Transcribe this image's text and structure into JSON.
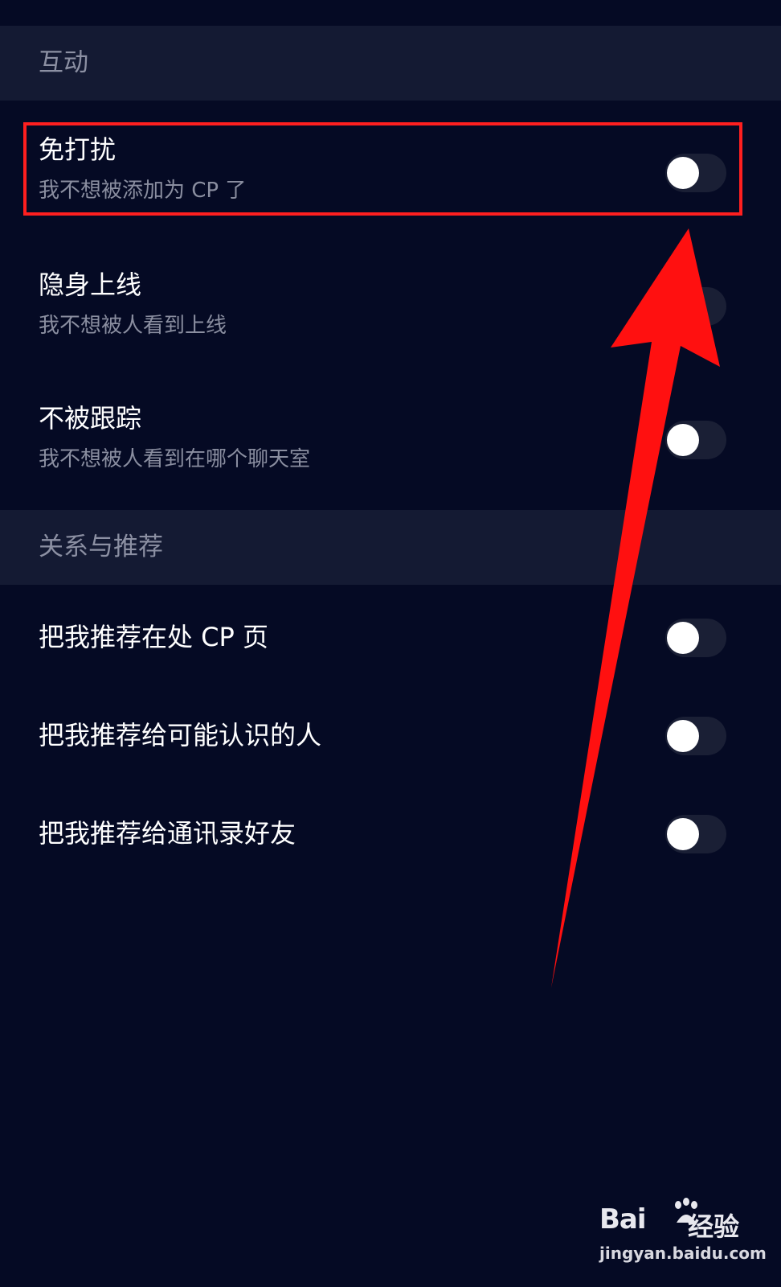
{
  "sections": [
    {
      "title": "互动"
    },
    {
      "title": "关系与推荐"
    }
  ],
  "interaction_items": [
    {
      "title": "免打扰",
      "subtitle": "我不想被添加为 CP 了",
      "enabled": false
    },
    {
      "title": "隐身上线",
      "subtitle": "我不想被人看到上线",
      "enabled": false
    },
    {
      "title": "不被跟踪",
      "subtitle": "我不想被人看到在哪个聊天室",
      "enabled": false
    }
  ],
  "recommend_items": [
    {
      "title": "把我推荐在处 CP 页",
      "enabled": false
    },
    {
      "title": "把我推荐给可能认识的人",
      "enabled": false
    },
    {
      "title": "把我推荐给通讯录好友",
      "enabled": false
    }
  ],
  "watermark": {
    "logo": "Bai",
    "logo_cn": "经验",
    "url": "jingyan.baidu.com"
  },
  "colors": {
    "background": "#050a24",
    "section_header": "#141a33",
    "highlight": "#ff1f1f",
    "arrow": "#ff1010",
    "toggle_track": "#1a1f35",
    "toggle_knob": "#ffffff"
  },
  "annotation": {
    "arrow_icon": "red-arrow-pointing-up",
    "highlight_target": "免打扰"
  }
}
